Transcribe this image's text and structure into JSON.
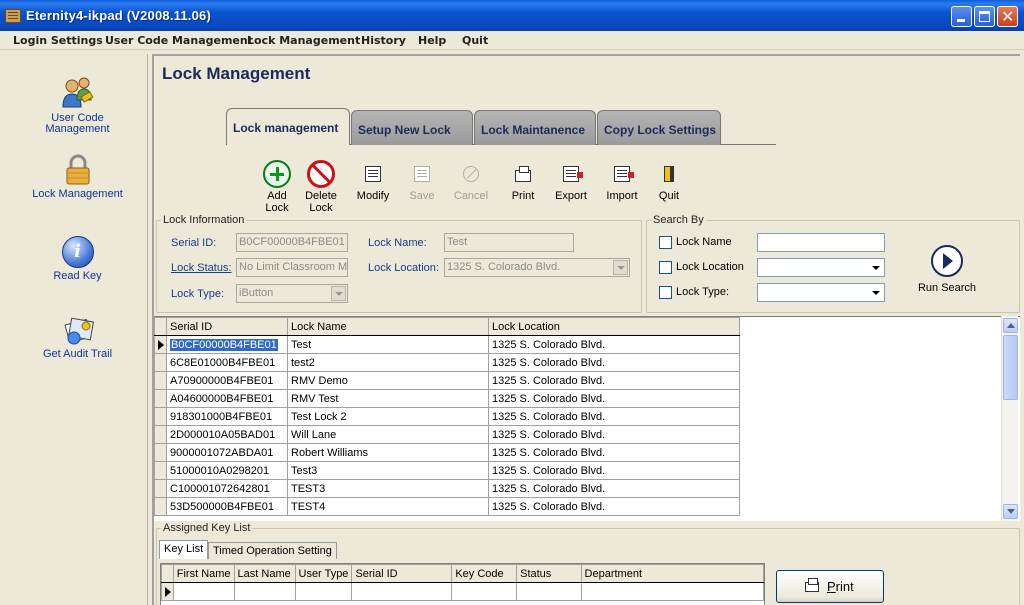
{
  "window": {
    "title": "Eternity4-ikpad   (V2008.11.06)"
  },
  "menu": [
    "Login Settings",
    "User Code Management",
    "Lock Management",
    "History",
    "Help",
    "Quit"
  ],
  "sidebar": {
    "items": [
      {
        "label_line1": "User Code",
        "label_line2": "Management",
        "icon": "users-icon"
      },
      {
        "label_line1": "Lock Management",
        "label_line2": "",
        "icon": "padlock-icon"
      },
      {
        "label_line1": "Read Key",
        "label_line2": "",
        "icon": "info-icon"
      },
      {
        "label_line1": "Get Audit Trail",
        "label_line2": "",
        "icon": "audit-trail-icon"
      }
    ]
  },
  "page": {
    "title": "Lock Management"
  },
  "tabs": [
    "Lock management",
    "Setup New Lock",
    "Lock Maintanence",
    "Copy Lock Settings"
  ],
  "toolbar": {
    "add": {
      "line1": "Add",
      "line2": "Lock"
    },
    "delete": {
      "line1": "Delete",
      "line2": "Lock"
    },
    "modify": "Modify",
    "save": "Save",
    "cancel": "Cancel",
    "print": "Print",
    "export": "Export",
    "import": "Import",
    "quit": "Quit"
  },
  "lock_info": {
    "title": "Lock Information",
    "serial_label": "Serial ID:",
    "serial_value": "B0CF00000B4FBE01",
    "name_label": "Lock Name:",
    "name_value": "Test",
    "status_label": "Lock Status:",
    "status_value": "No Limit Classroom Mo",
    "location_label": "Lock Location:",
    "location_value": "1325 S. Colorado Blvd.",
    "type_label": "Lock Type:",
    "type_value": "iButton"
  },
  "search_by": {
    "title": "Search By",
    "lock_name": "Lock Name",
    "lock_location": "Lock Location",
    "lock_type": "Lock Type:",
    "run_label": "Run Search"
  },
  "locks_table": {
    "headers": [
      "Serial ID",
      "Lock Name",
      "Lock Location"
    ],
    "rows": [
      [
        "B0CF00000B4FBE01",
        "Test",
        "1325 S. Colorado Blvd."
      ],
      [
        "6C8E01000B4FBE01",
        "test2",
        "1325 S. Colorado Blvd."
      ],
      [
        "A70900000B4FBE01",
        "RMV Demo",
        "1325 S. Colorado Blvd."
      ],
      [
        "A04600000B4FBE01",
        "RMV Test",
        "1325 S. Colorado Blvd."
      ],
      [
        "918301000B4FBE01",
        "Test Lock 2",
        "1325 S. Colorado Blvd."
      ],
      [
        "2D000010A05BAD01",
        "Will Lane",
        "1325 S. Colorado Blvd."
      ],
      [
        "9000001072ABDA01",
        "Robert Williams",
        "1325 S. Colorado Blvd."
      ],
      [
        "51000010A0298201",
        "Test3",
        "1325 S. Colorado Blvd."
      ],
      [
        "C100001072642801",
        "TEST3",
        "1325 S. Colorado Blvd."
      ],
      [
        "53D500000B4FBE01",
        "TEST4",
        "1325 S. Colorado Blvd."
      ]
    ]
  },
  "assigned": {
    "title": "Assigned Key List",
    "tabs": [
      "Key List",
      "Timed Operation Setting"
    ],
    "headers": [
      "First Name",
      "Last Name",
      "User Type",
      "Serial ID",
      "Key Code",
      "Status",
      "Department"
    ],
    "print_label": "Print"
  }
}
